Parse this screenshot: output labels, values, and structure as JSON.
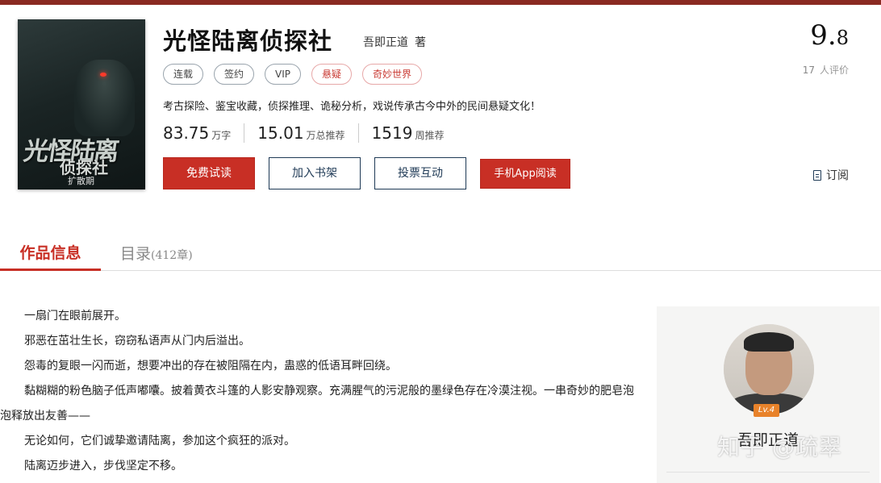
{
  "book": {
    "title": "光怪陆离侦探社",
    "author": "吾即正道",
    "author_suffix": "著",
    "tags": [
      {
        "label": "连载",
        "accent": false
      },
      {
        "label": "签约",
        "accent": false
      },
      {
        "label": "VIP",
        "accent": false
      },
      {
        "label": "悬疑",
        "accent": true
      },
      {
        "label": "奇妙世界",
        "accent": true
      }
    ],
    "intro": "考古探险、鉴宝收藏，侦探推理、诡秘分析，戏说传承古今中外的民间悬疑文化！",
    "stats": [
      {
        "num": "83.75",
        "unit": "万字"
      },
      {
        "num": "15.01",
        "unit": "万总推荐"
      },
      {
        "num": "1519",
        "unit": "周推荐"
      }
    ],
    "cover": {
      "title": "光怪陆离",
      "subtitle": "侦探社",
      "tag": "扩散期"
    }
  },
  "actions": {
    "free_read": "免费试读",
    "add_shelf": "加入书架",
    "vote": "投票互动",
    "app_read": "手机App阅读",
    "subscribe": "订阅"
  },
  "rating": {
    "score_int": "9.",
    "score_dec": "8",
    "count": "17",
    "count_label": "人评价"
  },
  "tabs": {
    "info": "作品信息",
    "toc": "目录",
    "toc_count": "(412章)"
  },
  "content": {
    "paragraphs": [
      "一扇门在眼前展开。",
      "邪恶在茁壮生长，窃窃私语声从门内后溢出。",
      "怨毒的复眼一闪而逝，想要冲出的存在被阻隔在内，蛊惑的低语耳畔回绕。",
      "黏糊糊的粉色脑子低声嘟囔。披着黄衣斗篷的人影安静观察。充满腥气的污泥般的墨绿色存在冷漠注视。一串奇妙的肥皂泡泡释放出友善——",
      "无论如何，它们诚挚邀请陆离，参加这个疯狂的派对。",
      "陆离迈步进入，步伐坚定不移。"
    ]
  },
  "sidebar": {
    "level": "Lv.4",
    "author_name": "吾即正道"
  },
  "watermark": "知乎 @疏翠",
  "colors": {
    "accent_red": "#c82f25",
    "navy": "#1f3a56",
    "level_orange": "#e8822a"
  }
}
